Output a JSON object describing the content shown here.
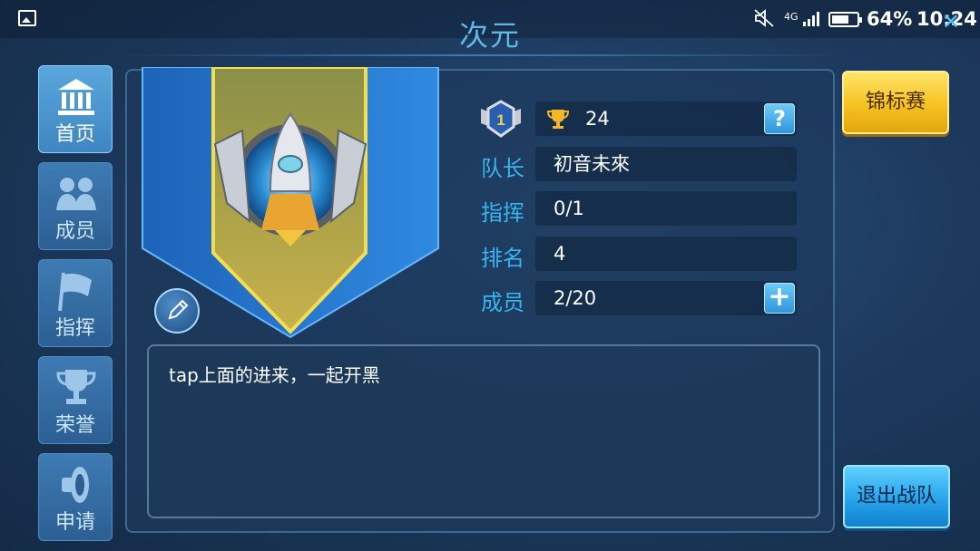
{
  "status_bar": {
    "network": "4G",
    "battery_percent": "64%",
    "time": "10:24"
  },
  "page_title": "次元",
  "sidebar": {
    "items": [
      {
        "label": "首页",
        "icon": "bank-icon",
        "active": true
      },
      {
        "label": "成员",
        "icon": "members-icon",
        "active": false
      },
      {
        "label": "指挥",
        "icon": "flag-icon",
        "active": false
      },
      {
        "label": "荣誉",
        "icon": "trophy-icon",
        "active": false
      },
      {
        "label": "申请",
        "icon": "speaker-icon",
        "active": false
      }
    ]
  },
  "team": {
    "rank_badge": "1",
    "trophies": "24",
    "rows": [
      {
        "label": "队长",
        "value": "初音未來"
      },
      {
        "label": "指挥",
        "value": "0/1"
      },
      {
        "label": "排名",
        "value": "4"
      },
      {
        "label": "成员",
        "value": "2/20"
      }
    ],
    "description": "tap上面的进来，一起开黑"
  },
  "buttons": {
    "championship": "锦标赛",
    "quit_team": "退出战队"
  },
  "colors": {
    "accent_blue": "#38b4f0",
    "gold": "#f6c21f",
    "panel_bg": "#1c3a5c"
  }
}
